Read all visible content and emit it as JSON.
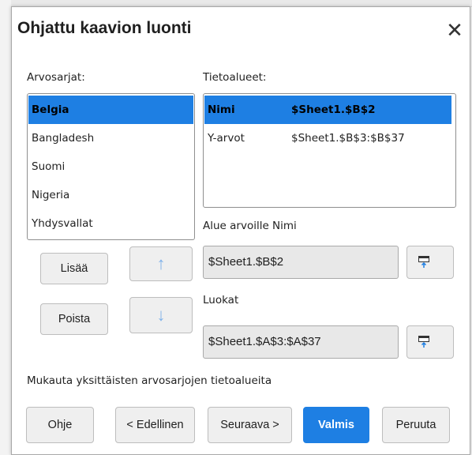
{
  "dialog": {
    "title": "Ohjattu kaavion luonti",
    "close_glyph": "✕"
  },
  "series": {
    "label": "Arvosarjat:",
    "items": [
      "Belgia",
      "Bangladesh",
      "Suomi",
      "Nigeria",
      "Yhdysvallat"
    ],
    "selected_index": 0
  },
  "ranges": {
    "label": "Tietoalueet:",
    "rows": [
      {
        "name": "Nimi",
        "value": "$Sheet1.$B$2"
      },
      {
        "name": "Y-arvot",
        "value": "$Sheet1.$B$3:$B$37"
      }
    ],
    "selected_index": 0
  },
  "range_for": {
    "label": "Alue arvoille Nimi",
    "value": "$Sheet1.$B$2"
  },
  "categories": {
    "label": "Luokat",
    "value": "$Sheet1.$A$3:$A$37"
  },
  "buttons": {
    "add": "Lisää",
    "remove": "Poista",
    "up": "↑",
    "down": "↓"
  },
  "customize_text": "Mukauta yksittäisten arvosarjojen tietoalueita",
  "footer": {
    "help": "Ohje",
    "back": "< Edellinen",
    "next": "Seuraava >",
    "finish": "Valmis",
    "cancel": "Peruuta"
  },
  "icons": {
    "close": "close-icon",
    "range_picker": "range-picker-icon"
  },
  "colors": {
    "accent": "#1e7fe3",
    "field_bg": "#e8e8e8",
    "arrow_disabled": "#7fb2ea"
  }
}
